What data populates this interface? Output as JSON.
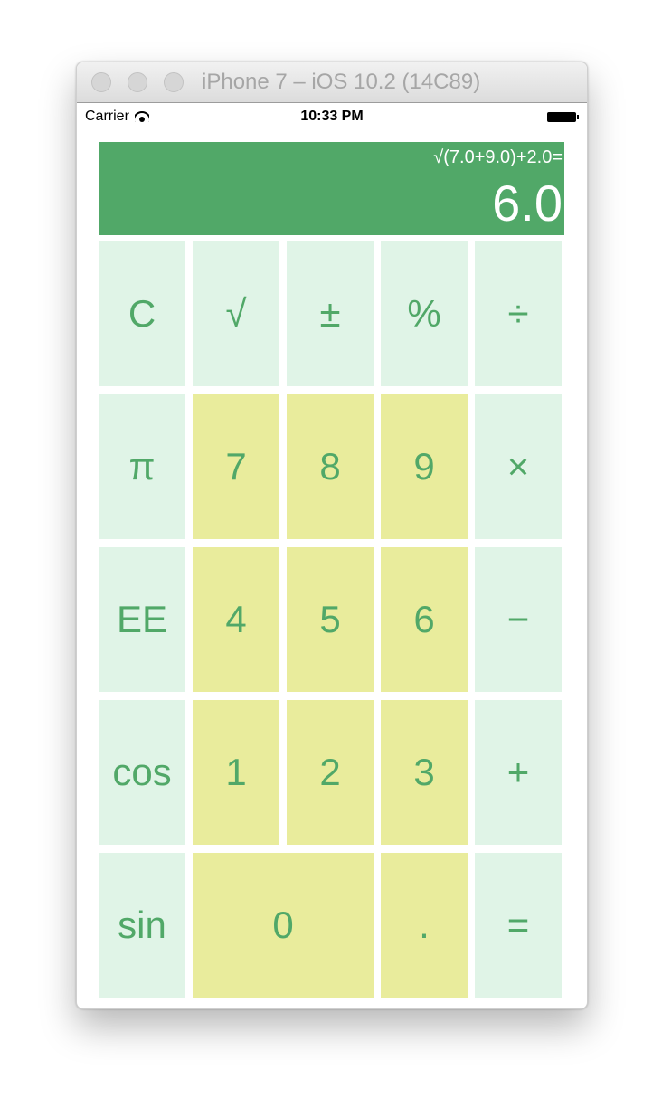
{
  "window": {
    "title": "iPhone 7 – iOS 10.2 (14C89)"
  },
  "status_bar": {
    "carrier": "Carrier",
    "time": "10:33 PM",
    "wifi_icon": "wifi-icon",
    "battery_icon": "battery-icon"
  },
  "display": {
    "expression": "√(7.0+9.0)+2.0=",
    "result": "6.0"
  },
  "keys": {
    "clear": "C",
    "sqrt": "√",
    "plus_minus": "±",
    "percent": "%",
    "divide": "÷",
    "pi": "π",
    "seven": "7",
    "eight": "8",
    "nine": "9",
    "multiply": "×",
    "ee": "EE",
    "four": "4",
    "five": "5",
    "six": "6",
    "minus": "−",
    "cos": "cos",
    "one": "1",
    "two": "2",
    "three": "3",
    "plus": "+",
    "sin": "sin",
    "zero": "0",
    "decimal": ".",
    "equals": "="
  },
  "colors": {
    "accent_green": "#51a868",
    "function_key_bg": "#e0f4e7",
    "number_key_bg": "#e9ec9c"
  }
}
